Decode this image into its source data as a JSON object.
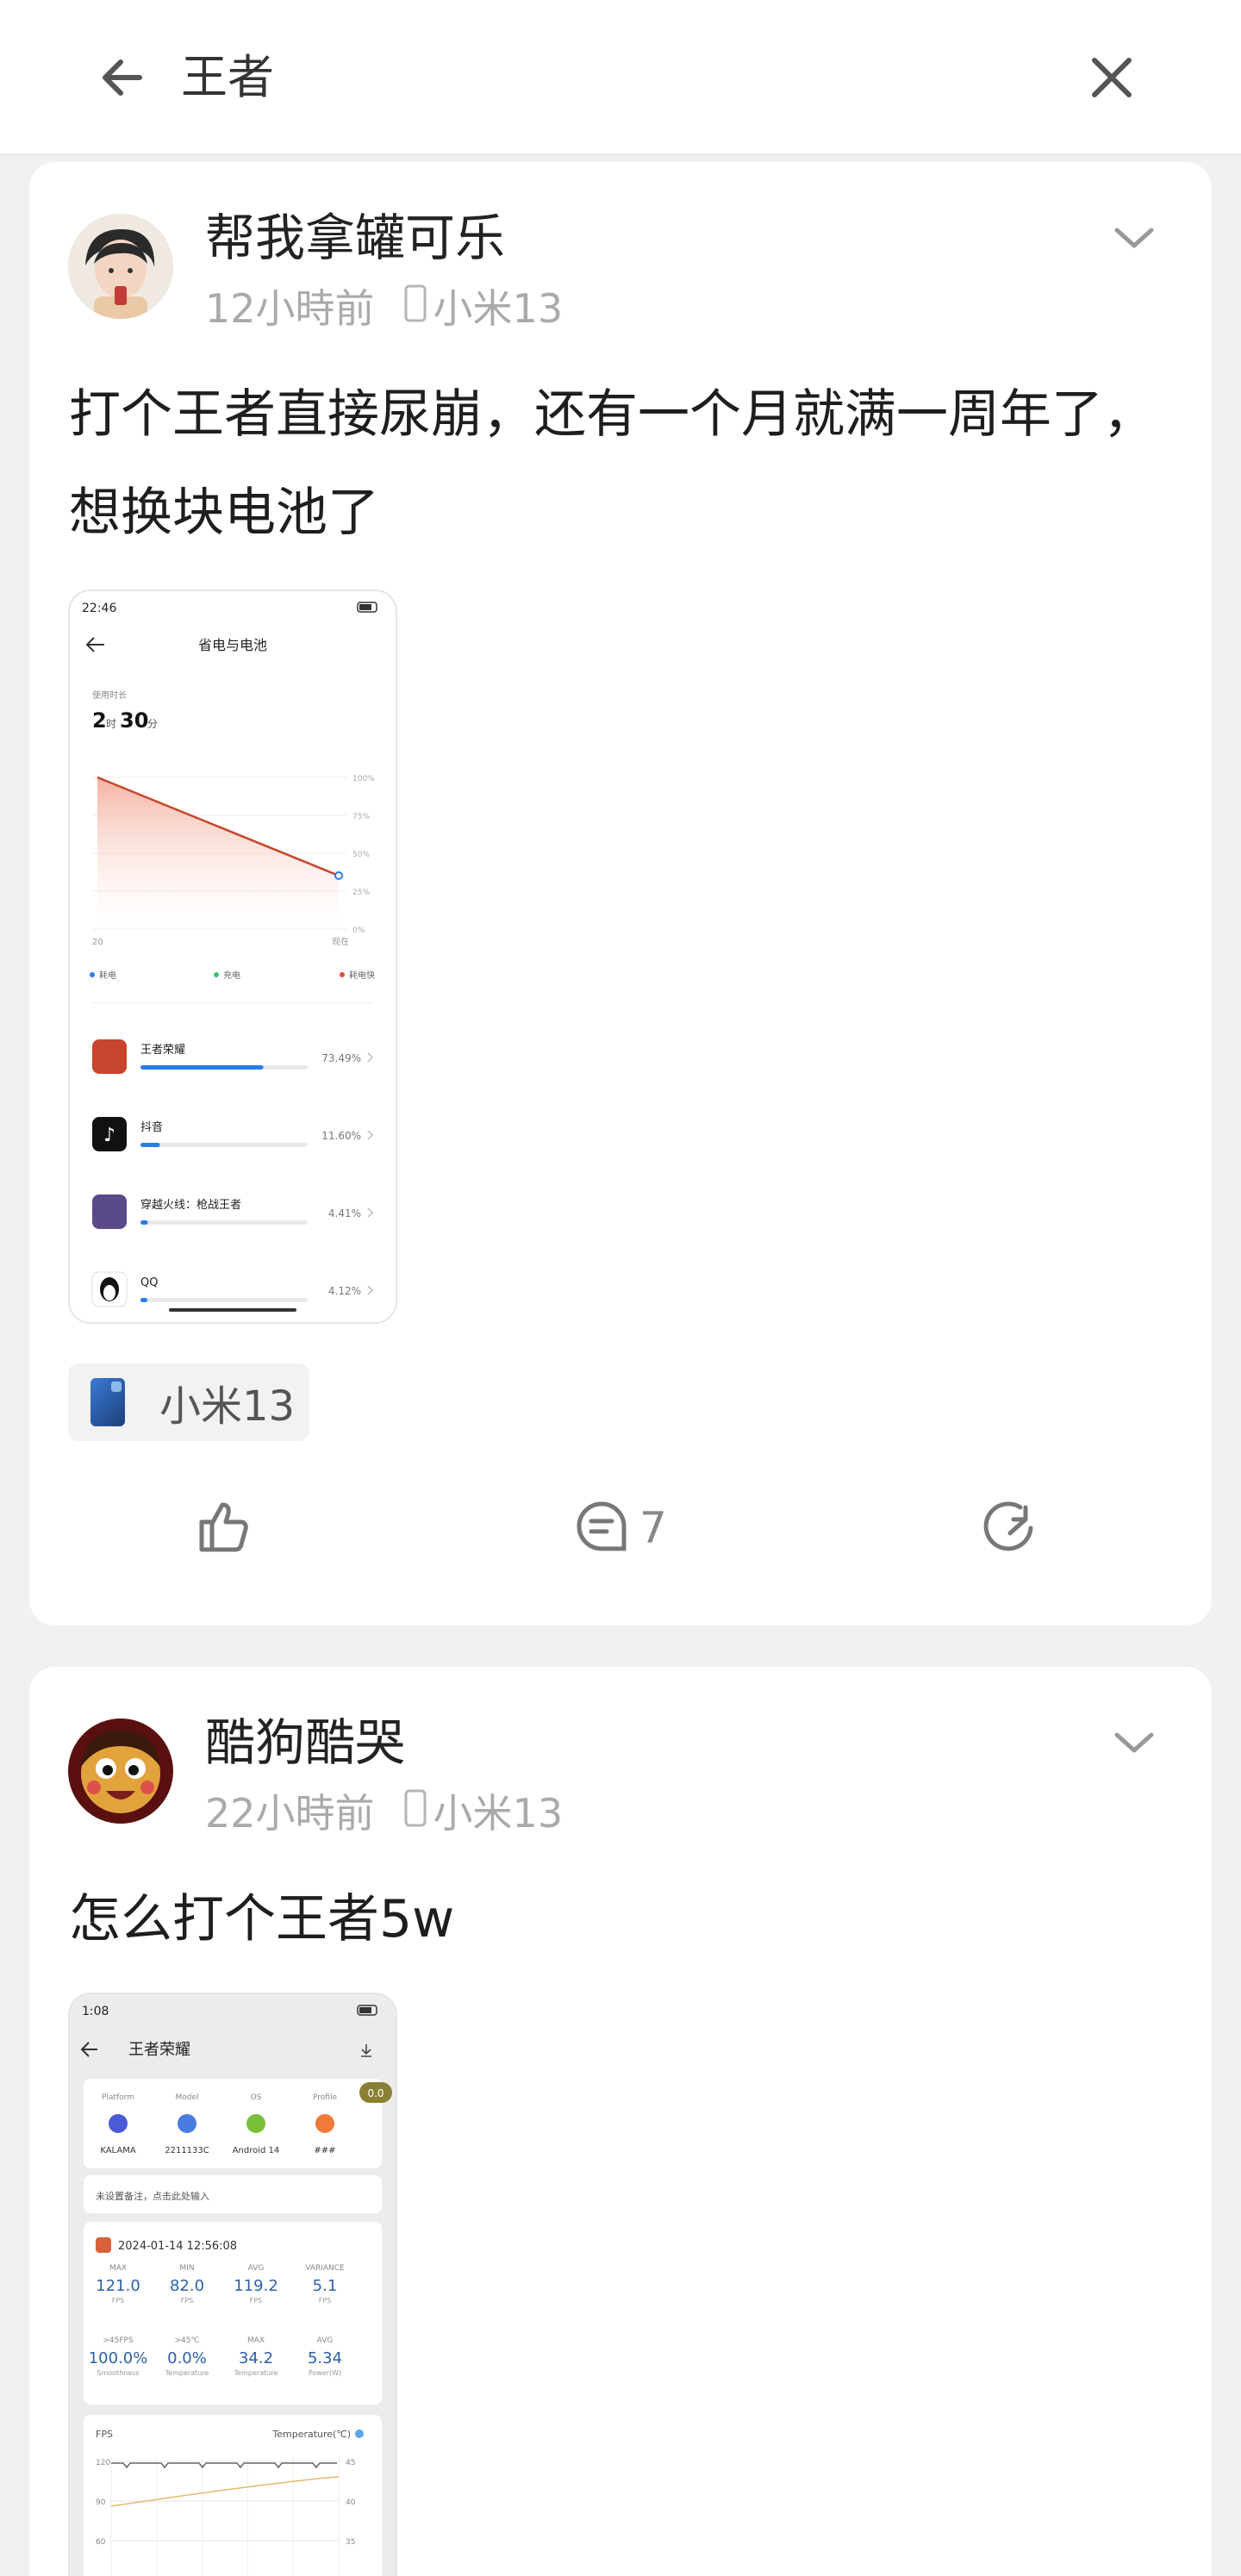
{
  "search": {
    "query": "王者"
  },
  "posts": [
    {
      "author": "帮我拿罐可乐",
      "time": "12小時前",
      "device": "小米13",
      "content": "打个王者直接尿崩，还有一个月就满一周年了，想换块电池了",
      "tag_device": "小米13",
      "comments": "7",
      "screenshot": {
        "status_time": "22:46",
        "title": "省电与电池",
        "usage_label": "使用时长",
        "usage_hours": "2",
        "usage_h_unit": "时",
        "usage_minutes": "30",
        "usage_m_unit": "分",
        "y_ticks": [
          "100%",
          "75%",
          "50%",
          "25%",
          "0%"
        ],
        "x_start": "20",
        "x_end": "现在",
        "legend": [
          "耗电",
          "充电",
          "耗电快"
        ],
        "legend_colors": [
          "#2b7de9",
          "#3cc36a",
          "#e0502c"
        ],
        "apps": [
          {
            "name": "王者荣耀",
            "pct": "73.49%",
            "fill": 0.7349,
            "icon": "honor-of-kings-icon"
          },
          {
            "name": "抖音",
            "pct": "11.60%",
            "fill": 0.116,
            "icon": "douyin-icon"
          },
          {
            "name": "穿越火线：枪战王者",
            "pct": "4.41%",
            "fill": 0.0441,
            "icon": "crossfire-icon"
          },
          {
            "name": "QQ",
            "pct": "4.12%",
            "fill": 0.0412,
            "icon": "qq-icon"
          }
        ]
      }
    },
    {
      "author": "酷狗酷哭",
      "time": "22小時前",
      "device": "小米13",
      "content": "怎么打个王者5w",
      "screenshot": {
        "status_time": "1:08",
        "title": "王者荣耀",
        "badge": "0.0",
        "info_headers": [
          "Platform",
          "Model",
          "OS",
          "Profile"
        ],
        "info_values": [
          "KALAMA",
          "2211133C",
          "Android 14",
          "###"
        ],
        "note": "未设置备注，点击此处输入",
        "session_time": "2024-01-14 12:56:08",
        "stats_row1": [
          {
            "label": "MAX",
            "value": "121.0",
            "unit": "FPS"
          },
          {
            "label": "MIN",
            "value": "82.0",
            "unit": "FPS"
          },
          {
            "label": "AVG",
            "value": "119.2",
            "unit": "FPS"
          },
          {
            "label": "VARIANCE",
            "value": "5.1",
            "unit": "FPS"
          }
        ],
        "stats_row2": [
          {
            "label": ">45FPS",
            "value": "100.0%",
            "unit": "Smoothness"
          },
          {
            "label": ">45℃",
            "value": "0.0%",
            "unit": "Temperature"
          },
          {
            "label": "MAX",
            "value": "34.2",
            "unit": "Temperature"
          },
          {
            "label": "AVG",
            "value": "5.34",
            "unit": "Power(W)"
          }
        ],
        "fps_label": "FPS",
        "temp_label": "Temperature(℃)",
        "fps_ticks": [
          "120",
          "90",
          "60"
        ],
        "temp_ticks": [
          "45",
          "40",
          "35"
        ]
      }
    }
  ]
}
